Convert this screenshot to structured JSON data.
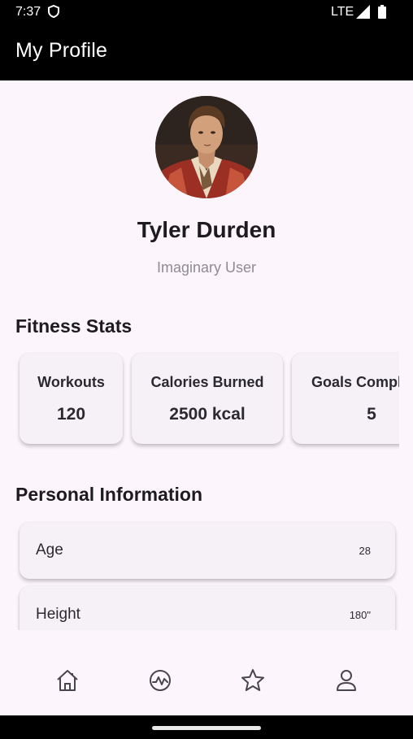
{
  "status_bar": {
    "time": "7:37",
    "network": "LTE",
    "icons": [
      "shield-icon",
      "signal-icon",
      "battery-icon"
    ]
  },
  "app_bar": {
    "title": "My Profile"
  },
  "profile": {
    "name": "Tyler Durden",
    "subtitle": "Imaginary User"
  },
  "fitness": {
    "title": "Fitness Stats",
    "stats": [
      {
        "label": "Workouts",
        "value": "120"
      },
      {
        "label": "Calories Burned",
        "value": "2500 kcal"
      },
      {
        "label": "Goals Completed",
        "value": "5"
      }
    ]
  },
  "personal": {
    "title": "Personal Information",
    "items": [
      {
        "label": "Age",
        "value": "28"
      },
      {
        "label": "Height",
        "value": "180\""
      }
    ]
  },
  "bottom_nav": {
    "items": [
      {
        "icon": "home-icon"
      },
      {
        "icon": "activity-icon"
      },
      {
        "icon": "star-icon"
      },
      {
        "icon": "profile-icon"
      }
    ]
  },
  "colors": {
    "background": "#fcf6fc",
    "app_bar": "#000000",
    "card": "#f6f1f7",
    "text": "#1d1b20",
    "subtitle": "#8e8b92"
  }
}
